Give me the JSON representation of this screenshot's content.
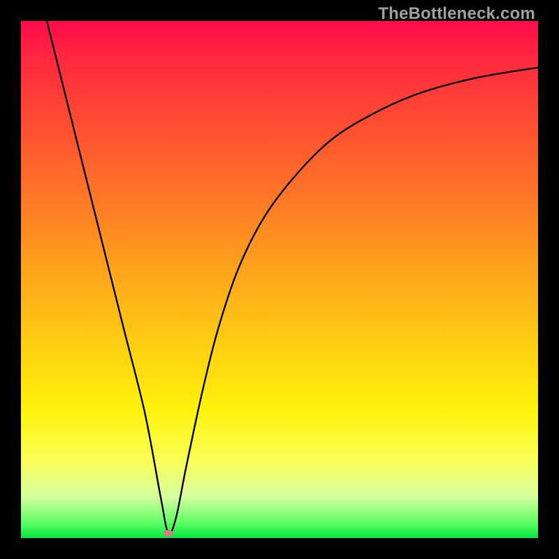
{
  "watermark": "TheBottleneck.com",
  "chart_data": {
    "type": "line",
    "title": "",
    "xlabel": "",
    "ylabel": "",
    "xlim": [
      0,
      100
    ],
    "ylim": [
      0,
      100
    ],
    "grid": false,
    "legend": false,
    "series": [
      {
        "name": "curve",
        "x": [
          5,
          8,
          12,
          16,
          20,
          24,
          27,
          28.5,
          30,
          32,
          35,
          38,
          42,
          47,
          53,
          60,
          68,
          77,
          88,
          100
        ],
        "y": [
          100,
          88,
          72,
          56,
          40,
          24,
          8,
          1,
          4,
          14,
          28,
          40,
          52,
          62,
          70,
          77,
          82,
          86,
          89,
          91
        ]
      }
    ],
    "marker": {
      "x": 28.5,
      "y": 1,
      "color": "#d77b7e"
    },
    "background_gradient_top_to_bottom": [
      "#ff0b4a",
      "#ff5330",
      "#ffa31c",
      "#fff20a",
      "#faff58",
      "#06e63e"
    ]
  }
}
